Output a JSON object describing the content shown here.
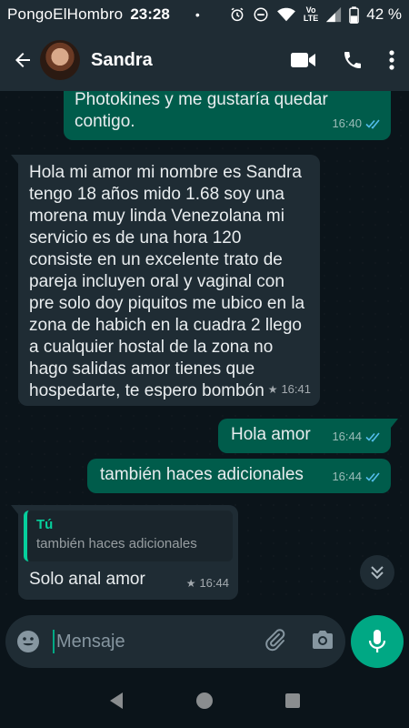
{
  "status_bar": {
    "carrier": "PongoElHombro",
    "time": "23:28",
    "dot": "•",
    "volte_top": "Vo",
    "volte_bottom": "LTE",
    "battery": "42 %"
  },
  "header": {
    "contact_name": "Sandra"
  },
  "messages": [
    {
      "direction": "out",
      "text": "Photokines y me gustaría quedar contigo.",
      "time": "16:40"
    },
    {
      "direction": "in",
      "text": "Hola mi amor mi nombre es Sandra tengo 18 años mido 1.68 soy una morena muy linda Venezolana mi servicio es de una hora 120 consiste en un excelente trato de pareja incluyen oral y vaginal con pre solo doy piquitos me ubico en la zona de habich en la cuadra 2 llego a cualquier hostal de la zona no hago salidas amor tienes que hospedarte, te espero bombón",
      "time": "16:41"
    },
    {
      "direction": "out",
      "text": "Hola amor",
      "time": "16:44"
    },
    {
      "direction": "out",
      "text": "también haces adicionales",
      "time": "16:44"
    },
    {
      "direction": "in",
      "quote_author": "Tú",
      "quote_text": "también haces adicionales",
      "text": "Solo anal amor",
      "time": "16:44"
    }
  ],
  "input": {
    "placeholder": "Mensaje"
  },
  "colors": {
    "outgoing_bubble": "#005c4b",
    "incoming_bubble": "#1f2c34",
    "accent": "#00a884",
    "read_ticks": "#53bdeb",
    "background": "#0b141a"
  },
  "icons": {
    "back": "arrow-left-icon",
    "video": "video-camera-icon",
    "call": "phone-icon",
    "menu": "more-vert-icon",
    "emoji": "emoji-icon",
    "attach": "paperclip-icon",
    "camera": "camera-icon",
    "mic": "microphone-icon",
    "scroll_down": "double-chevron-down-icon",
    "starred": "star-icon",
    "read": "double-check-icon"
  }
}
